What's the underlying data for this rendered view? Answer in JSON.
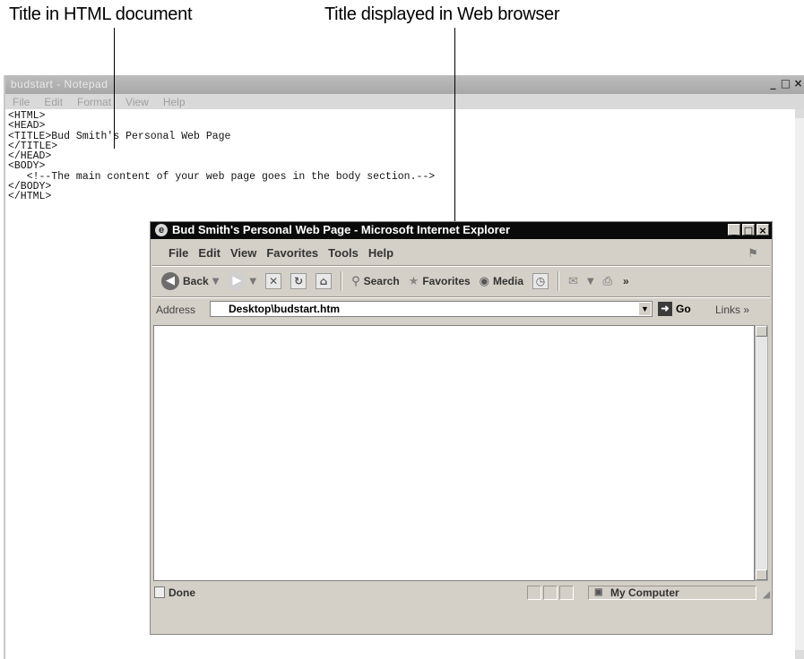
{
  "callouts": {
    "left": "Title in HTML document",
    "right": "Title displayed in Web browser"
  },
  "notepad": {
    "title": "budstart - Notepad",
    "menu": [
      "File",
      "Edit",
      "Format",
      "View",
      "Help"
    ],
    "content": "<HTML>\n<HEAD>\n<TITLE>Bud Smith's Personal Web Page\n</TITLE>\n</HEAD>\n<BODY>\n   <!--The main content of your web page goes in the body section.-->\n</BODY>\n</HTML>",
    "controls": {
      "minimize": "_",
      "maximize": "□",
      "close": "×"
    }
  },
  "browser": {
    "title": "Bud Smith's Personal Web Page - Microsoft Internet Explorer",
    "menu": [
      "File",
      "Edit",
      "View",
      "Favorites",
      "Tools",
      "Help"
    ],
    "toolbar": {
      "back": "Back",
      "search": "Search",
      "favorites": "Favorites",
      "media": "Media",
      "overflow": "»"
    },
    "address": {
      "label": "Address",
      "value": "Desktop\\budstart.htm",
      "go": "Go",
      "links": "Links »"
    },
    "status": {
      "text": "Done",
      "zone": "My Computer"
    }
  },
  "icons": {
    "notepad_window": "notepad-icon",
    "ie_logo": "internet-explorer-icon",
    "back": "back-arrow-icon",
    "forward": "forward-arrow-icon",
    "stop": "stop-icon",
    "refresh": "refresh-icon",
    "home": "home-icon",
    "search": "search-icon",
    "favorites": "star-icon",
    "media": "media-icon",
    "history": "history-icon",
    "mail": "mail-icon",
    "print": "print-icon",
    "go": "go-arrow-icon",
    "windows_flag": "windows-logo-icon",
    "status_page": "page-icon",
    "status_zone": "computer-icon"
  }
}
